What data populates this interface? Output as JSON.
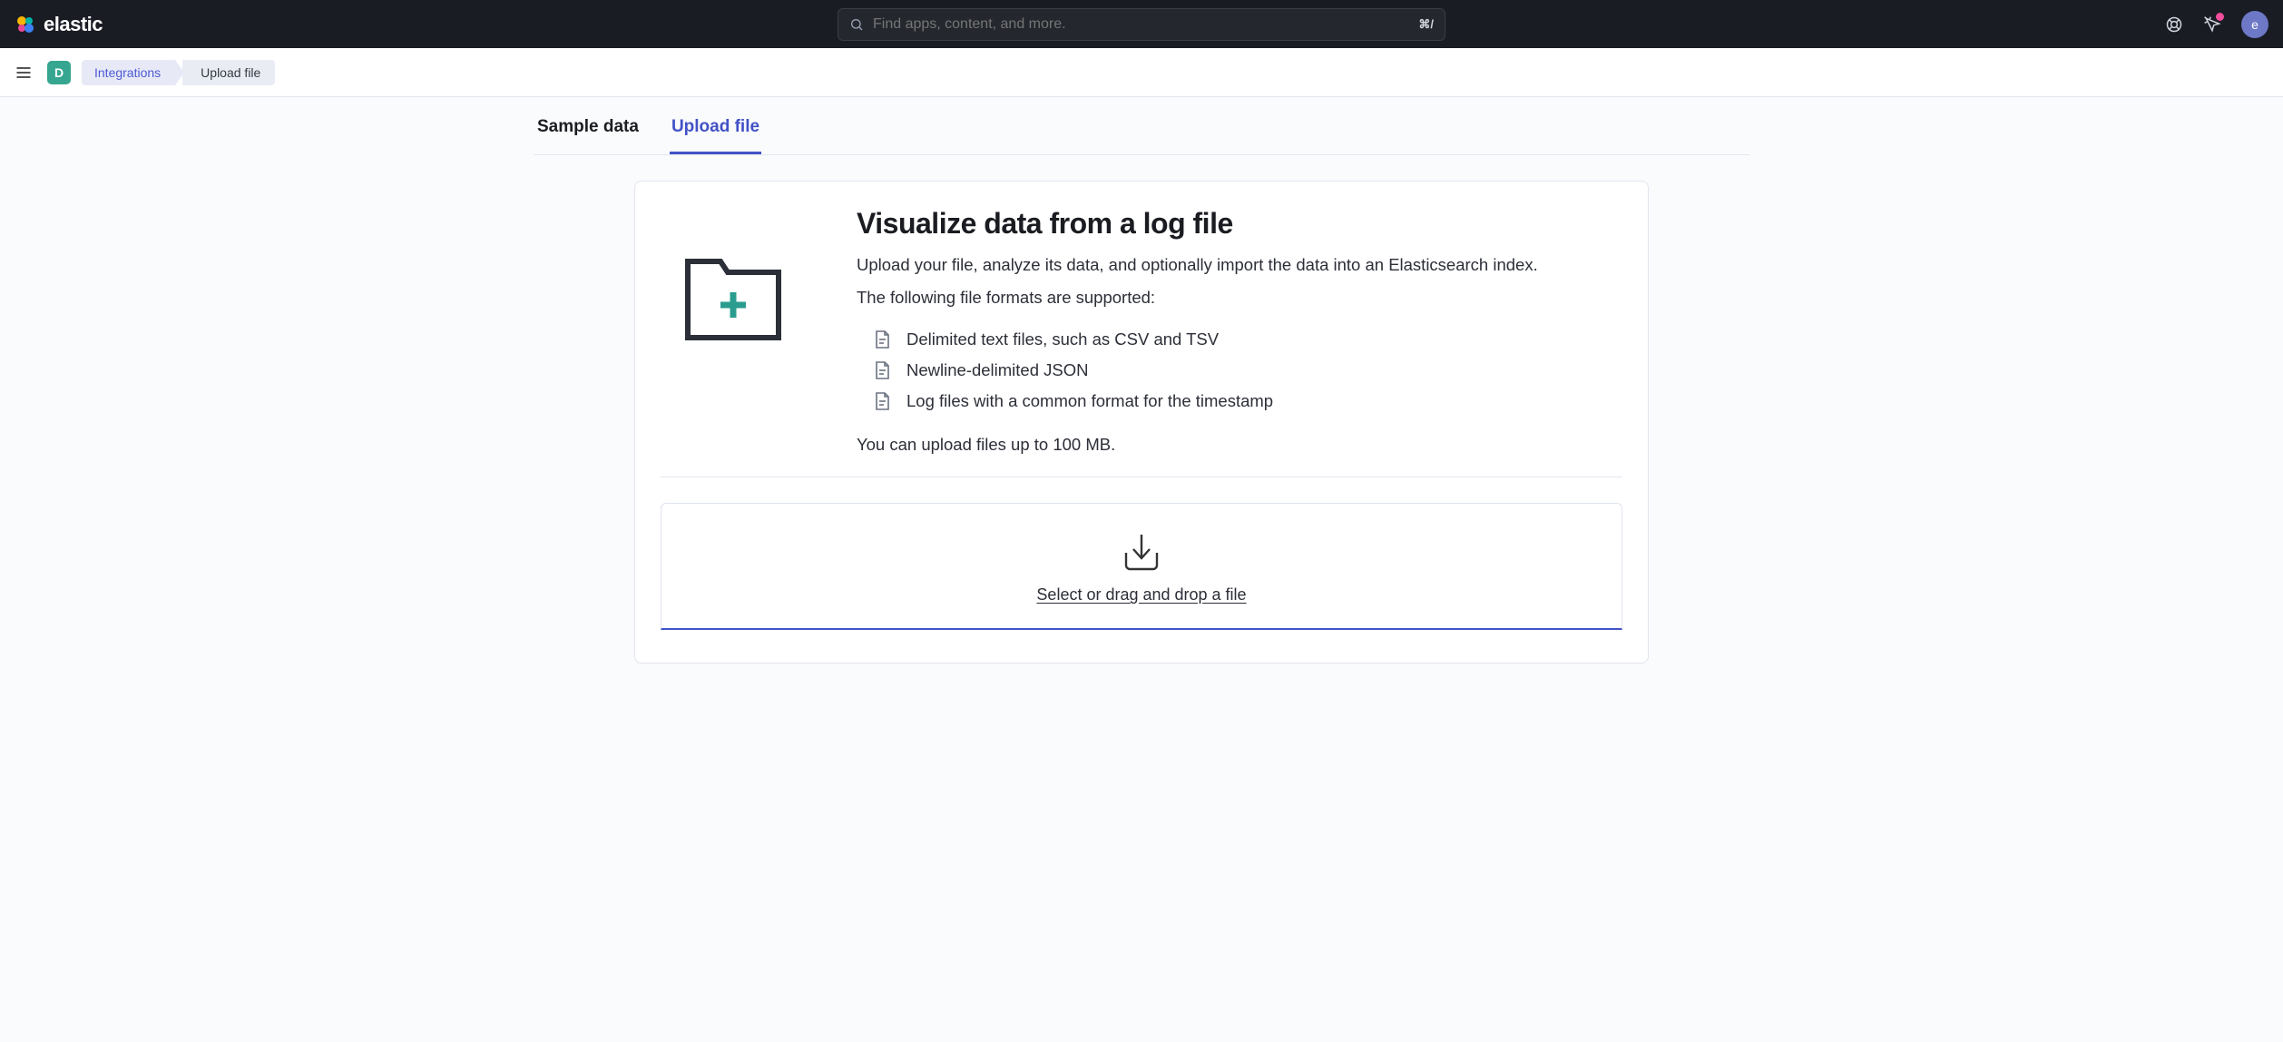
{
  "header": {
    "brand": "elastic",
    "search_placeholder": "Find apps, content, and more.",
    "search_shortcut": "⌘/",
    "avatar_letter": "e"
  },
  "breadcrumb": {
    "space_badge": "D",
    "items": [
      "Integrations",
      "Upload file"
    ]
  },
  "tabs": {
    "items": [
      "Sample data",
      "Upload file"
    ],
    "active_index": 1
  },
  "content": {
    "title": "Visualize data from a log file",
    "lead": "Upload your file, analyze its data, and optionally import the data into an Elasticsearch index.",
    "formats_intro": "The following file formats are supported:",
    "formats": [
      "Delimited text files, such as CSV and TSV",
      "Newline-delimited JSON",
      "Log files with a common format for the timestamp"
    ],
    "limit": "You can upload files up to 100 MB."
  },
  "dropzone": {
    "label": "Select or drag and drop a file"
  }
}
